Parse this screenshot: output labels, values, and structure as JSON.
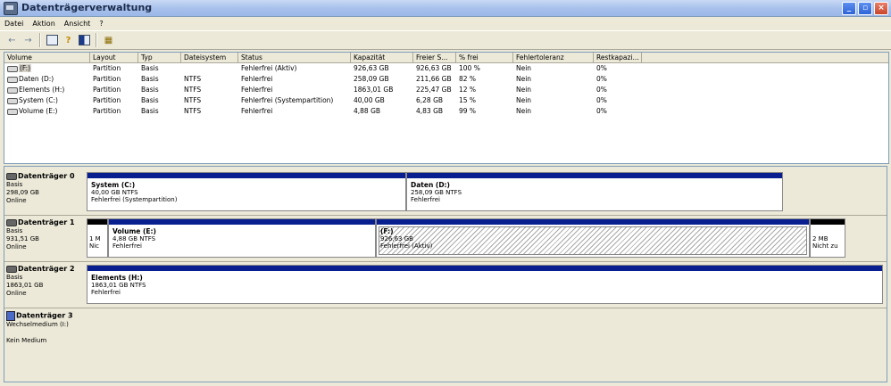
{
  "window": {
    "title": "Datenträgerverwaltung"
  },
  "menu": [
    "Datei",
    "Aktion",
    "Ansicht",
    "?"
  ],
  "toolbar": {
    "icons": [
      "back-icon",
      "forward-icon",
      "properties-icon",
      "help-icon",
      "view-icon",
      "settings-icon"
    ]
  },
  "volume_table": {
    "columns": [
      "Volume",
      "Layout",
      "Typ",
      "Dateisystem",
      "Status",
      "Kapazität",
      "Freier S...",
      "% frei",
      "Fehlertoleranz",
      "Restkapazi..."
    ],
    "rows": [
      [
        "(F:)",
        "Partition",
        "Basis",
        "",
        "Fehlerfrei (Aktiv)",
        "926,63 GB",
        "926,63 GB",
        "100 %",
        "Nein",
        "0%"
      ],
      [
        "Daten (D:)",
        "Partition",
        "Basis",
        "NTFS",
        "Fehlerfrei",
        "258,09 GB",
        "211,66 GB",
        "82 %",
        "Nein",
        "0%"
      ],
      [
        "Elements (H:)",
        "Partition",
        "Basis",
        "NTFS",
        "Fehlerfrei",
        "1863,01 GB",
        "225,47 GB",
        "12 %",
        "Nein",
        "0%"
      ],
      [
        "System (C:)",
        "Partition",
        "Basis",
        "NTFS",
        "Fehlerfrei (Systempartition)",
        "40,00 GB",
        "6,28 GB",
        "15 %",
        "Nein",
        "0%"
      ],
      [
        "Volume (E:)",
        "Partition",
        "Basis",
        "NTFS",
        "Fehlerfrei",
        "4,88 GB",
        "4,83 GB",
        "99 %",
        "Nein",
        "0%"
      ]
    ]
  },
  "disks": [
    {
      "name": "Datenträger 0",
      "type": "Basis",
      "size": "298,09 GB",
      "status": "Online",
      "partitions": [
        {
          "title": "System  (C:)",
          "line2": "40,00 GB NTFS",
          "line3": "Fehlerfrei (Systempartition)"
        },
        {
          "title": "Daten  (D:)",
          "line2": "258,09 GB NTFS",
          "line3": "Fehlerfrei"
        }
      ]
    },
    {
      "name": "Datenträger 1",
      "type": "Basis",
      "size": "931,51 GB",
      "status": "Online",
      "small_left": {
        "line1": "1 M",
        "line2": "Nic"
      },
      "partitions": [
        {
          "title": "Volume  (E:)",
          "line2": "4,88 GB NTFS",
          "line3": "Fehlerfrei"
        },
        {
          "title": "(F:)",
          "line2": "926,63 GB",
          "line3": "Fehlerfrei (Aktiv)"
        }
      ],
      "small_right": {
        "line1": "2 MB",
        "line2": "Nicht zu"
      }
    },
    {
      "name": "Datenträger 2",
      "type": "Basis",
      "size": "1863,01 GB",
      "status": "Online",
      "partitions": [
        {
          "title": "Elements  (H:)",
          "line2": "1863,01 GB NTFS",
          "line3": "Fehlerfrei"
        }
      ]
    },
    {
      "name": "Datenträger 3",
      "type": "Wechselmedium (I:)",
      "status": "Kein Medium"
    }
  ]
}
